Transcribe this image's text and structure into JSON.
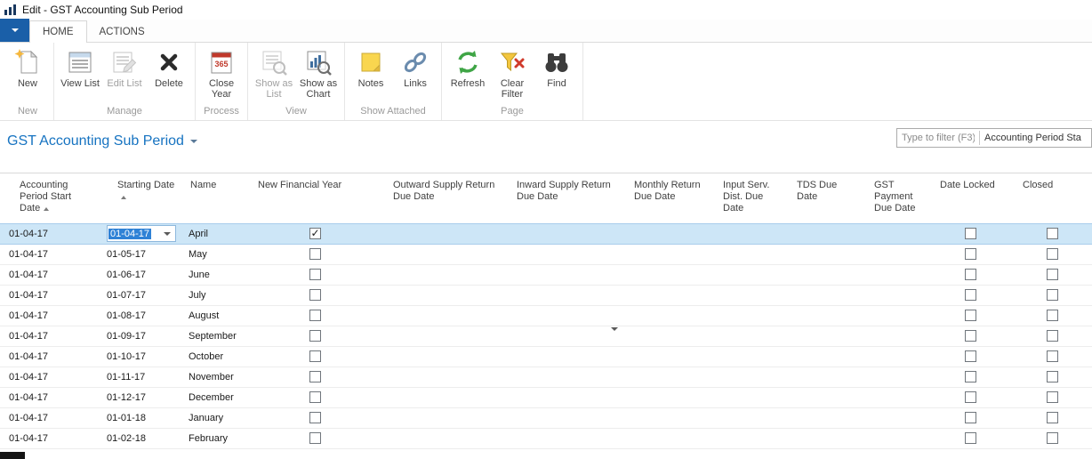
{
  "window": {
    "title": "Edit - GST Accounting Sub Period"
  },
  "ribbon": {
    "tabs": [
      {
        "label": "HOME"
      },
      {
        "label": "ACTIONS"
      }
    ],
    "groups": [
      {
        "label": "New",
        "buttons": [
          {
            "label": "New",
            "icon": "new-document-icon"
          }
        ]
      },
      {
        "label": "Manage",
        "buttons": [
          {
            "label": "View List",
            "icon": "view-list-icon"
          },
          {
            "label": "Edit List",
            "icon": "edit-list-icon",
            "disabled": true
          },
          {
            "label": "Delete",
            "icon": "delete-icon"
          }
        ]
      },
      {
        "label": "Process",
        "buttons": [
          {
            "label": "Close Year",
            "icon": "close-year-icon"
          }
        ]
      },
      {
        "label": "View",
        "buttons": [
          {
            "label": "Show as List",
            "icon": "show-as-list-icon",
            "disabled": true
          },
          {
            "label": "Show as Chart",
            "icon": "show-as-chart-icon"
          }
        ]
      },
      {
        "label": "Show Attached",
        "buttons": [
          {
            "label": "Notes",
            "icon": "notes-icon"
          },
          {
            "label": "Links",
            "icon": "links-icon"
          }
        ]
      },
      {
        "label": "Page",
        "buttons": [
          {
            "label": "Refresh",
            "icon": "refresh-icon"
          },
          {
            "label": "Clear Filter",
            "icon": "clear-filter-icon"
          },
          {
            "label": "Find",
            "icon": "find-icon"
          }
        ]
      }
    ]
  },
  "page": {
    "title": "GST Accounting Sub Period",
    "filter": {
      "placeholder": "Type to filter (F3)",
      "column": "Accounting Period Sta"
    }
  },
  "table": {
    "columns": [
      {
        "label": "Accounting Period Start Date",
        "sortable": true
      },
      {
        "label": "Starting Date",
        "sortable": true
      },
      {
        "label": "Name"
      },
      {
        "label": "New Financial Year"
      },
      {
        "label": "Outward Supply Return Due Date"
      },
      {
        "label": "Inward Supply Return Due Date"
      },
      {
        "label": "Monthly Return Due Date"
      },
      {
        "label": "Input Serv. Dist. Due Date"
      },
      {
        "label": "TDS Due Date"
      },
      {
        "label": "GST Payment Due Date"
      },
      {
        "label": "Date Locked"
      },
      {
        "label": "Closed"
      }
    ],
    "rows": [
      {
        "acct_start": "01-04-17",
        "starting_date": "01-04-17",
        "name": "April",
        "new_financial_year": true,
        "date_locked": false,
        "closed": false,
        "selected": true,
        "editing": true
      },
      {
        "acct_start": "01-04-17",
        "starting_date": "01-05-17",
        "name": "May",
        "new_financial_year": false,
        "date_locked": false,
        "closed": false
      },
      {
        "acct_start": "01-04-17",
        "starting_date": "01-06-17",
        "name": "June",
        "new_financial_year": false,
        "date_locked": false,
        "closed": false
      },
      {
        "acct_start": "01-04-17",
        "starting_date": "01-07-17",
        "name": "July",
        "new_financial_year": false,
        "date_locked": false,
        "closed": false
      },
      {
        "acct_start": "01-04-17",
        "starting_date": "01-08-17",
        "name": "August",
        "new_financial_year": false,
        "date_locked": false,
        "closed": false
      },
      {
        "acct_start": "01-04-17",
        "starting_date": "01-09-17",
        "name": "September",
        "new_financial_year": false,
        "date_locked": false,
        "closed": false,
        "inward_dropdown": true
      },
      {
        "acct_start": "01-04-17",
        "starting_date": "01-10-17",
        "name": "October",
        "new_financial_year": false,
        "date_locked": false,
        "closed": false
      },
      {
        "acct_start": "01-04-17",
        "starting_date": "01-11-17",
        "name": "November",
        "new_financial_year": false,
        "date_locked": false,
        "closed": false
      },
      {
        "acct_start": "01-04-17",
        "starting_date": "01-12-17",
        "name": "December",
        "new_financial_year": false,
        "date_locked": false,
        "closed": false
      },
      {
        "acct_start": "01-04-17",
        "starting_date": "01-01-18",
        "name": "January",
        "new_financial_year": false,
        "date_locked": false,
        "closed": false
      },
      {
        "acct_start": "01-04-17",
        "starting_date": "01-02-18",
        "name": "February",
        "new_financial_year": false,
        "date_locked": false,
        "closed": false
      }
    ]
  },
  "colors": {
    "accent_blue": "#1673c1",
    "app_menu_blue": "#1a5fa8",
    "selected_row": "#cde6f7",
    "edit_selection": "#2f82d6"
  }
}
